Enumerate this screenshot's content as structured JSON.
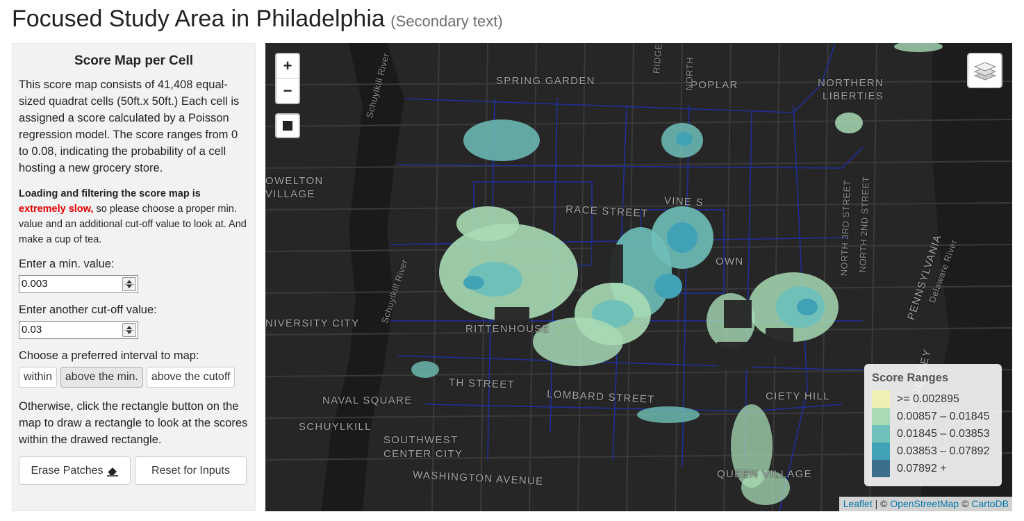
{
  "page": {
    "title": "Focused Study Area in Philadelphia",
    "subtitle": "(Secondary text)"
  },
  "sidebar": {
    "title": "Score Map per Cell",
    "description": "This score map consists of 41,408 equal-sized quadrat cells (50ft.x 50ft.) Each cell is assigned a score calculated by a Poisson regression model. The score ranges from 0 to 0.08, indicating the probability of a cell hosting a new grocery store.",
    "warning_bold": "Loading and filtering the score map is",
    "warning_red": "extremely slow,",
    "warning_rest": " so please choose a proper min. value and an additional cut-off value to look at. And make a cup of tea.",
    "min_label": "Enter a min. value:",
    "min_value": "0.003",
    "cutoff_label": "Enter another cut-off value:",
    "cutoff_value": "0.03",
    "interval_label": "Choose a preferred interval to map:",
    "interval_options": [
      "within",
      "above the min.",
      "above the cutoff"
    ],
    "interval_selected": "above the min.",
    "rect_instructions": "Otherwise, click the rectangle button on the map to draw a rectangle to look at the scores within the drawed rectangle.",
    "erase_label": "Erase Patches",
    "erase_icon": "eraser-icon",
    "reset_label": "Reset for Inputs"
  },
  "map": {
    "zoom_in": "+",
    "zoom_out": "−",
    "draw_rect_icon": "square-icon",
    "layers_icon": "layers-icon",
    "labels": [
      {
        "text": "SPRING GARDEN"
      },
      {
        "text": "POPLAR"
      },
      {
        "text": "NORTHERN"
      },
      {
        "text": "LIBERTIES"
      },
      {
        "text": "OWELTON"
      },
      {
        "text": "VILLAGE"
      },
      {
        "text": "RACE STREET"
      },
      {
        "text": "VINE S"
      },
      {
        "text": "OWN"
      },
      {
        "text": "NIVERSITY CITY"
      },
      {
        "text": "RITTENHOUSE"
      },
      {
        "text": "NAVAL SQUARE"
      },
      {
        "text": "SCHUYLKILL"
      },
      {
        "text": "SOUTHWEST"
      },
      {
        "text": "CENTER CITY"
      },
      {
        "text": "CIETY HILL"
      },
      {
        "text": "QUEEN VILLAGE"
      },
      {
        "text": "TH STREET"
      },
      {
        "text": "LOMBARD STREET"
      },
      {
        "text": "WASHINGTON AVENUE"
      },
      {
        "text": "RIDGE AVE"
      },
      {
        "text": "NORTH"
      },
      {
        "text": "NORTH 3RD STREET"
      },
      {
        "text": "NORTH 2ND STREET"
      },
      {
        "text": "PENNSYLVANIA"
      },
      {
        "text": "Delaware River"
      },
      {
        "text": "NEW JERSEY"
      },
      {
        "text": "Schuylkill River"
      },
      {
        "text": "Schuylkill River"
      }
    ],
    "legend": {
      "title": "Score Ranges",
      "items": [
        {
          "label": ">= 0.002895",
          "color": "#f0f0b4"
        },
        {
          "label": "0.00857 – 0.01845",
          "color": "#a8dbb5"
        },
        {
          "label": "0.01845 – 0.03853",
          "color": "#6fc0b8"
        },
        {
          "label": "0.03853 – 0.07892",
          "color": "#41a2b6"
        },
        {
          "label": "0.07892 +",
          "color": "#3b6f8c"
        }
      ]
    },
    "attribution": {
      "leaflet": "Leaflet",
      "sep1": " | © ",
      "osm": "OpenStreetMap",
      "sep2": " © ",
      "carto": "CartoDB"
    }
  }
}
